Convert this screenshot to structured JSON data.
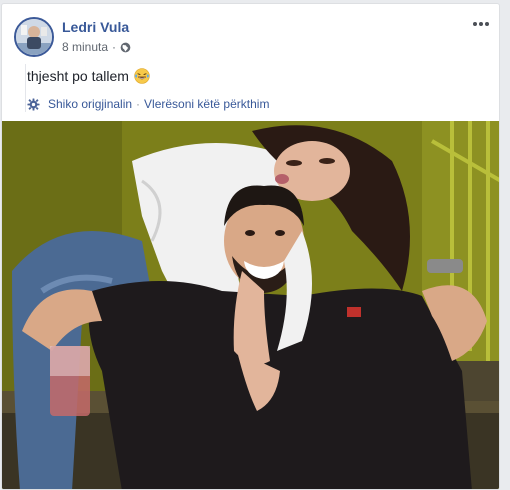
{
  "post": {
    "author": "Ledri Vula",
    "time": "8 minuta",
    "text": "thjesht po tallem",
    "emoji_icon": "laughing-tears-emoji",
    "visibility_icon": "globe-icon"
  },
  "translation": {
    "see_original": "Shiko origjinalin",
    "separator": "·",
    "rate": "Vlerësoni këtë përkthim"
  },
  "colors": {
    "link": "#385898",
    "muted": "#616770",
    "text": "#1d2129"
  }
}
